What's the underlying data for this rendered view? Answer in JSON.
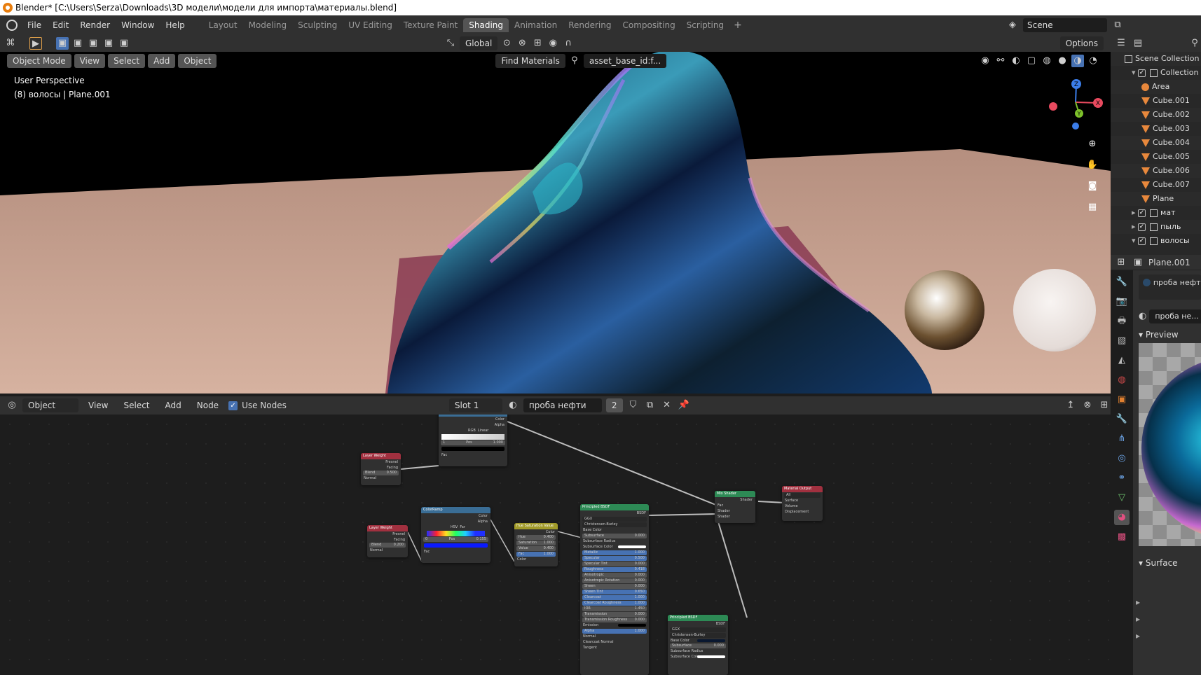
{
  "window": {
    "title": "Blender* [C:\\Users\\Serza\\Downloads\\3D модели\\модели для импорта\\материалы.blend]"
  },
  "menu": [
    "File",
    "Edit",
    "Render",
    "Window",
    "Help"
  ],
  "workspaces": [
    "Layout",
    "Modeling",
    "Sculpting",
    "UV Editing",
    "Texture Paint",
    "Shading",
    "Animation",
    "Rendering",
    "Compositing",
    "Scripting"
  ],
  "active_workspace": "Shading",
  "scene": {
    "name": "Scene"
  },
  "viewport": {
    "mode": "Object Mode",
    "menus": [
      "View",
      "Select",
      "Add",
      "Object"
    ],
    "transform": "Global",
    "find_materials": "Find Materials",
    "asset": "asset_base_id:f...",
    "options": "Options",
    "perspective": "User Perspective",
    "object_info": "(8) волосы | Plane.001",
    "gizmo": {
      "x": "X",
      "y": "Y",
      "z": "Z"
    }
  },
  "node_editor": {
    "type": "Object",
    "menus": [
      "View",
      "Select",
      "Add",
      "Node"
    ],
    "use_nodes": "Use Nodes",
    "slot": "Slot 1",
    "material": "проба нефти",
    "users": "2",
    "nodes": {
      "layer_weight_1": {
        "title": "Layer Weight",
        "out1": "Fresnel",
        "out2": "Facing",
        "blend_label": "Blend",
        "blend": "0.500",
        "in": "Normal"
      },
      "layer_weight_2": {
        "title": "Layer Weight",
        "out1": "Fresnel",
        "out2": "Facing",
        "blend_label": "Blend",
        "blend": "0.200",
        "in": "Normal"
      },
      "color_ramp_top": {
        "out1": "Color",
        "out2": "Alpha",
        "mode": "RGB",
        "interp": "Linear",
        "idx": "1",
        "pos_label": "Pos",
        "pos": "1.000",
        "in": "Fac"
      },
      "color_ramp": {
        "title": "ColorRamp",
        "out1": "Color",
        "out2": "Alpha",
        "mode": "HSV",
        "interp": "Far",
        "idx": "0",
        "pos_label": "Pos",
        "pos": "0.155",
        "in": "Fac"
      },
      "hsv": {
        "title": "Hue Saturation Value",
        "out": "Color",
        "rows": [
          [
            "Hue",
            "0.400"
          ],
          [
            "Saturation",
            "1.000"
          ],
          [
            "Value",
            "0.400"
          ],
          [
            "Fac",
            "1.000"
          ]
        ],
        "in": "Color"
      },
      "principled_1": {
        "title": "Principled BSDF",
        "out": "BSDF",
        "dist": "GGX",
        "sss": "Christensen-Burley",
        "rows": [
          [
            "Base Color",
            ""
          ],
          [
            "Subsurface",
            "0.000"
          ],
          [
            "Subsurface Radius",
            ""
          ],
          [
            "Subsurface Color",
            ""
          ],
          [
            "Metallic",
            "1.000"
          ],
          [
            "Specular",
            "0.500"
          ],
          [
            "Specular Tint",
            "0.000"
          ],
          [
            "Roughness",
            "0.418"
          ],
          [
            "Anisotropic",
            "0.000"
          ],
          [
            "Anisotropic Rotation",
            "0.000"
          ],
          [
            "Sheen",
            "0.000"
          ],
          [
            "Sheen Tint",
            "0.650"
          ],
          [
            "Clearcoat",
            "1.000"
          ],
          [
            "Clearcoat Roughness",
            "1.000"
          ],
          [
            "IOR",
            "1.450"
          ],
          [
            "Transmission",
            "0.000"
          ],
          [
            "Transmission Roughness",
            "0.000"
          ],
          [
            "Emission",
            ""
          ],
          [
            "Alpha",
            "1.000"
          ],
          [
            "Normal",
            ""
          ],
          [
            "Clearcoat Normal",
            ""
          ],
          [
            "Tangent",
            ""
          ]
        ]
      },
      "principled_2": {
        "title": "Principled BSDF",
        "out": "BSDF",
        "dist": "GGX",
        "sss": "Christensen-Burley",
        "rows": [
          [
            "Base Color",
            ""
          ],
          [
            "Subsurface",
            "0.000"
          ],
          [
            "Subsurface Radius",
            ""
          ],
          [
            "Subsurface Color",
            ""
          ]
        ]
      },
      "mix": {
        "title": "Mix Shader",
        "out": "Shader",
        "rows": [
          "Fac",
          "Shader",
          "Shader"
        ]
      },
      "output": {
        "title": "Material Output",
        "target": "All",
        "rows": [
          "Surface",
          "Volume",
          "Displacement"
        ]
      }
    }
  },
  "outliner": {
    "root": "Scene Collection",
    "items": [
      {
        "name": "Collection",
        "type": "collection",
        "checked": true
      },
      {
        "name": "Area",
        "type": "light"
      },
      {
        "name": "Cube.001",
        "type": "mesh"
      },
      {
        "name": "Cube.002",
        "type": "mesh"
      },
      {
        "name": "Cube.003",
        "type": "mesh"
      },
      {
        "name": "Cube.004",
        "type": "mesh"
      },
      {
        "name": "Cube.005",
        "type": "mesh"
      },
      {
        "name": "Cube.006",
        "type": "mesh"
      },
      {
        "name": "Cube.007",
        "type": "mesh"
      },
      {
        "name": "Plane",
        "type": "mesh"
      },
      {
        "name": "мат",
        "type": "collection",
        "checked": true
      },
      {
        "name": "пыль",
        "type": "collection",
        "checked": true
      },
      {
        "name": "волосы",
        "type": "collection",
        "checked": true
      }
    ]
  },
  "properties": {
    "object": "Plane.001",
    "material_slot": "проба нефти",
    "material_field": "проба не...",
    "preview": "Preview",
    "surface": "Surface"
  }
}
